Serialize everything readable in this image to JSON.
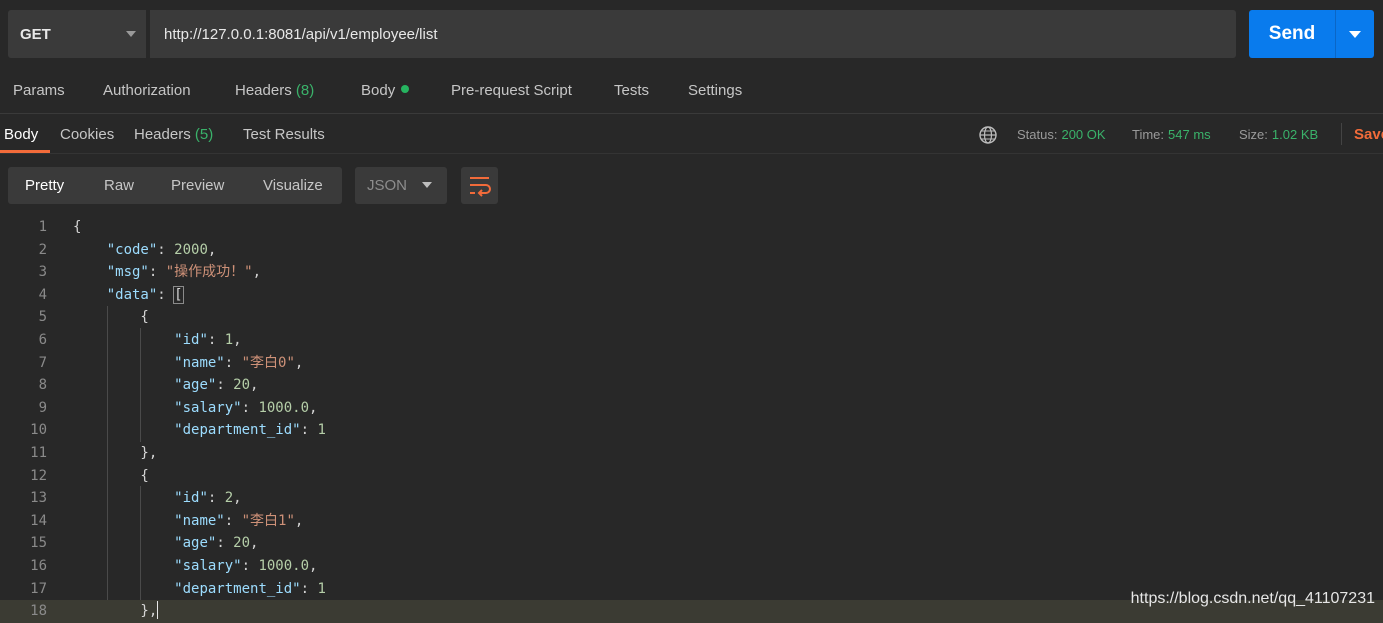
{
  "request": {
    "method": "GET",
    "url": "http://127.0.0.1:8081/api/v1/employee/list",
    "send_label": "Send"
  },
  "request_tabs": {
    "params": "Params",
    "authorization": "Authorization",
    "headers": "Headers",
    "headers_count": "(8)",
    "body": "Body",
    "prerequest": "Pre-request Script",
    "tests": "Tests",
    "settings": "Settings"
  },
  "response_tabs": {
    "body": "Body",
    "cookies": "Cookies",
    "headers": "Headers",
    "headers_count": "(5)",
    "test_results": "Test Results"
  },
  "response_meta": {
    "status_label": "Status:",
    "status_value": "200 OK",
    "time_label": "Time:",
    "time_value": "547 ms",
    "size_label": "Size:",
    "size_value": "1.02 KB",
    "save_label": "Save"
  },
  "view": {
    "pretty": "Pretty",
    "raw": "Raw",
    "preview": "Preview",
    "visualize": "Visualize",
    "format": "JSON"
  },
  "code_lines": [
    {
      "num": "1"
    },
    {
      "num": "2"
    },
    {
      "num": "3"
    },
    {
      "num": "4"
    },
    {
      "num": "5"
    },
    {
      "num": "6"
    },
    {
      "num": "7"
    },
    {
      "num": "8"
    },
    {
      "num": "9"
    },
    {
      "num": "10"
    },
    {
      "num": "11"
    },
    {
      "num": "12"
    },
    {
      "num": "13"
    },
    {
      "num": "14"
    },
    {
      "num": "15"
    },
    {
      "num": "16"
    },
    {
      "num": "17"
    },
    {
      "num": "18"
    }
  ],
  "json": {
    "code_key": "\"code\"",
    "code_val": "2000",
    "msg_key": "\"msg\"",
    "msg_val": "\"操作成功！\"",
    "data_key": "\"data\"",
    "id_key": "\"id\"",
    "name_key": "\"name\"",
    "age_key": "\"age\"",
    "salary_key": "\"salary\"",
    "dept_key": "\"department_id\"",
    "items": [
      {
        "id": "1",
        "name": "\"李白0\"",
        "age": "20",
        "salary": "1000.0",
        "department_id": "1"
      },
      {
        "id": "2",
        "name": "\"李白1\"",
        "age": "20",
        "salary": "1000.0",
        "department_id": "1"
      }
    ]
  },
  "watermark": "https://blog.csdn.net/qq_41107231",
  "colors": {
    "accent_orange": "#f26b3a",
    "send_blue": "#097bed",
    "status_green": "#3ab26a"
  }
}
